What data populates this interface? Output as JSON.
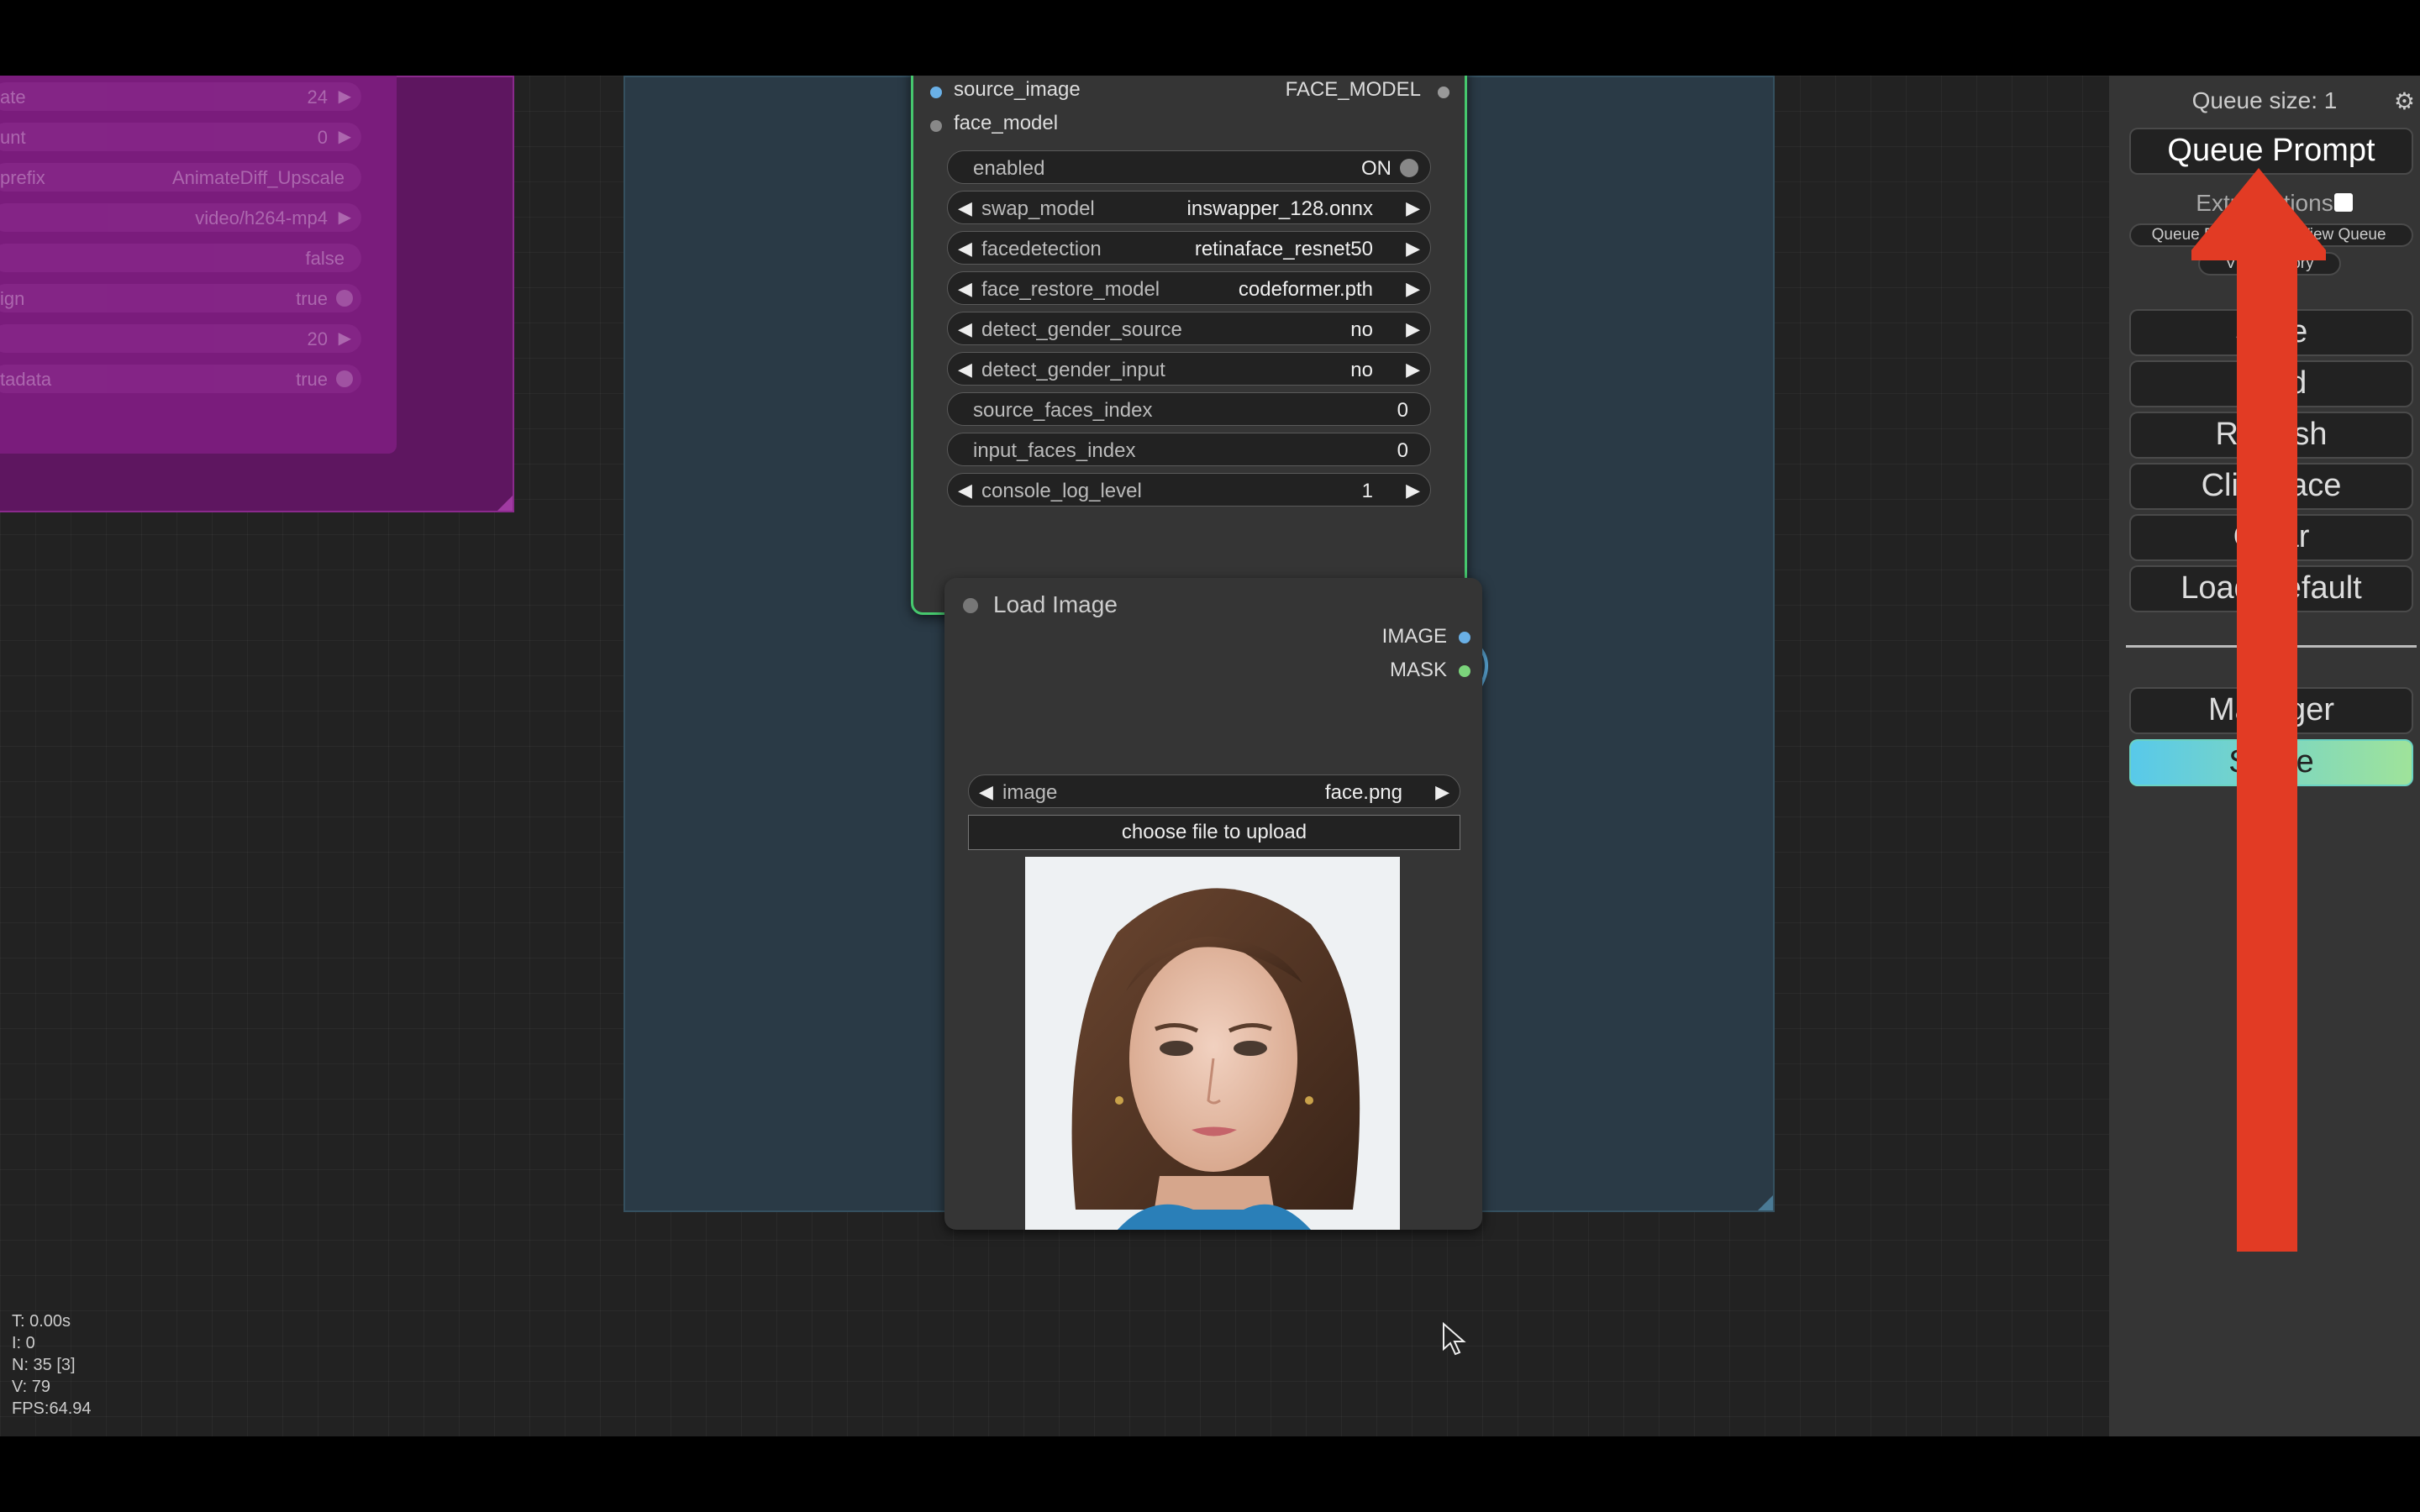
{
  "purple_node": {
    "widgets": [
      {
        "label": "ate",
        "value": "24",
        "kind": "number"
      },
      {
        "label": "unt",
        "value": "0",
        "kind": "number"
      },
      {
        "label": "prefix",
        "value": "AnimateDiff_Upscale",
        "kind": "text"
      },
      {
        "label": "",
        "value": "video/h264-mp4",
        "kind": "combo"
      },
      {
        "label": "",
        "value": "false",
        "kind": "text"
      },
      {
        "label": "ign",
        "value": "true",
        "kind": "toggle"
      },
      {
        "label": "",
        "value": "20",
        "kind": "number"
      },
      {
        "label": "tadata",
        "value": "true",
        "kind": "toggle"
      }
    ]
  },
  "reactor_node": {
    "inputs": {
      "source_image": "source_image",
      "face_model": "face_model"
    },
    "output": "FACE_MODEL",
    "widgets": {
      "enabled": {
        "label": "enabled",
        "value": "ON"
      },
      "swap_model": {
        "label": "swap_model",
        "value": "inswapper_128.onnx"
      },
      "facedetection": {
        "label": "facedetection",
        "value": "retinaface_resnet50"
      },
      "face_restore_model": {
        "label": "face_restore_model",
        "value": "codeformer.pth"
      },
      "detect_gender_source": {
        "label": "detect_gender_source",
        "value": "no"
      },
      "detect_gender_input": {
        "label": "detect_gender_input",
        "value": "no"
      },
      "source_faces_index": {
        "label": "source_faces_index",
        "value": "0"
      },
      "input_faces_index": {
        "label": "input_faces_index",
        "value": "0"
      },
      "console_log_level": {
        "label": "console_log_level",
        "value": "1"
      }
    }
  },
  "load_image_node": {
    "title": "Load Image",
    "outputs": {
      "image": "IMAGE",
      "mask": "MASK"
    },
    "image_widget": {
      "label": "image",
      "value": "face.png"
    },
    "upload_label": "choose file to upload",
    "preview_alt": "face.png"
  },
  "stats": {
    "t": "T: 0.00s",
    "i": "I: 0",
    "n": "N: 35 [3]",
    "v": "V: 79",
    "fps": "FPS:64.94"
  },
  "menu": {
    "queue_size": "Queue size: 1",
    "queue_prompt": "Queue Prompt",
    "extra_options": "Extra options",
    "queue_front": "Queue Front",
    "view_queue": "View Queue",
    "view_history": "View History",
    "buttons": [
      "Save",
      "Load",
      "Refresh",
      "Clipspace",
      "Clear",
      "Load Default"
    ],
    "manager": "Manager",
    "share": "Share"
  },
  "colors": {
    "reactor_border": "#46c86e",
    "purple_group": "#5e1660",
    "blue_group": "#2a3a46",
    "annotation_arrow": "#e23b24",
    "share_gradient": [
      "#58c9ea",
      "#9fe39a"
    ],
    "wire": "#5aa8d8"
  },
  "icons": [
    "gear-icon",
    "mouse-cursor-icon",
    "red-arrow-annotation"
  ]
}
